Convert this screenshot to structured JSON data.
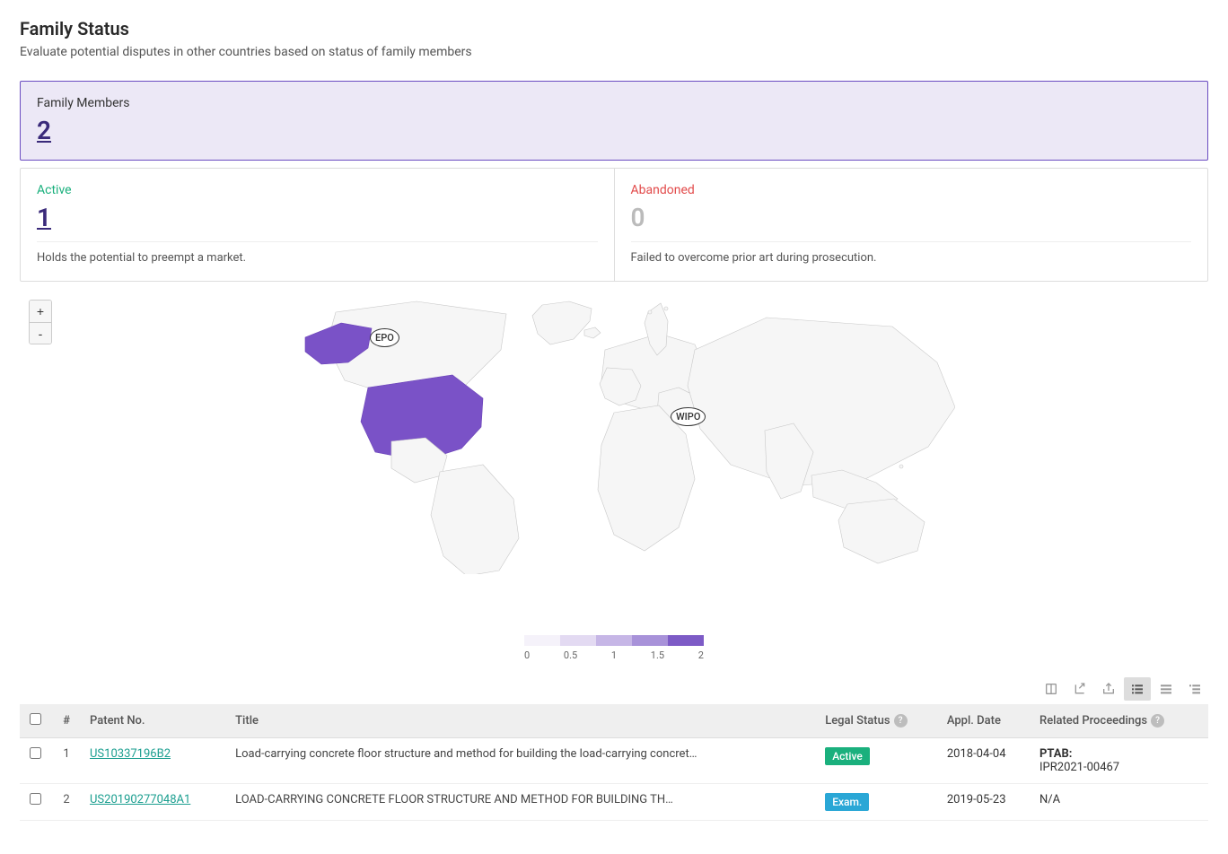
{
  "header": {
    "title": "Family Status",
    "subtitle": "Evaluate potential disputes in other countries based on status of family members"
  },
  "summary": {
    "label": "Family Members",
    "value": "2"
  },
  "stats": {
    "active": {
      "label": "Active",
      "value": "1",
      "desc": "Holds the potential to preempt a market."
    },
    "abandoned": {
      "label": "Abandoned",
      "value": "0",
      "desc": "Failed to overcome prior art during prosecution."
    }
  },
  "map": {
    "zoom_in": "+",
    "zoom_out": "-",
    "labels": {
      "epo": "EPO",
      "wipo": "WIPO"
    },
    "legend_ticks": [
      "0",
      "0.5",
      "1",
      "1.5",
      "2"
    ],
    "legend_colors": [
      "#f5f2fa",
      "#e3daf2",
      "#c6b6e6",
      "#a892d9",
      "#7d5bc6"
    ]
  },
  "table": {
    "headers": {
      "num": "#",
      "patent": "Patent No.",
      "title": "Title",
      "legal": "Legal Status",
      "appl": "Appl. Date",
      "proc": "Related Proceedings"
    },
    "rows": [
      {
        "num": "1",
        "patent": "US10337196B2",
        "title": "Load-carrying concrete floor structure and method for building the load-carrying concret…",
        "status": "Active",
        "status_kind": "active",
        "appl": "2018-04-04",
        "proc_label": "PTAB:",
        "proc_value": "IPR2021-00467"
      },
      {
        "num": "2",
        "patent": "US20190277048A1",
        "title": "LOAD-CARRYING CONCRETE FLOOR STRUCTURE AND METHOD FOR BUILDING TH…",
        "status": "Exam.",
        "status_kind": "exam",
        "appl": "2019-05-23",
        "proc_label": "",
        "proc_value": "N/A"
      }
    ]
  }
}
